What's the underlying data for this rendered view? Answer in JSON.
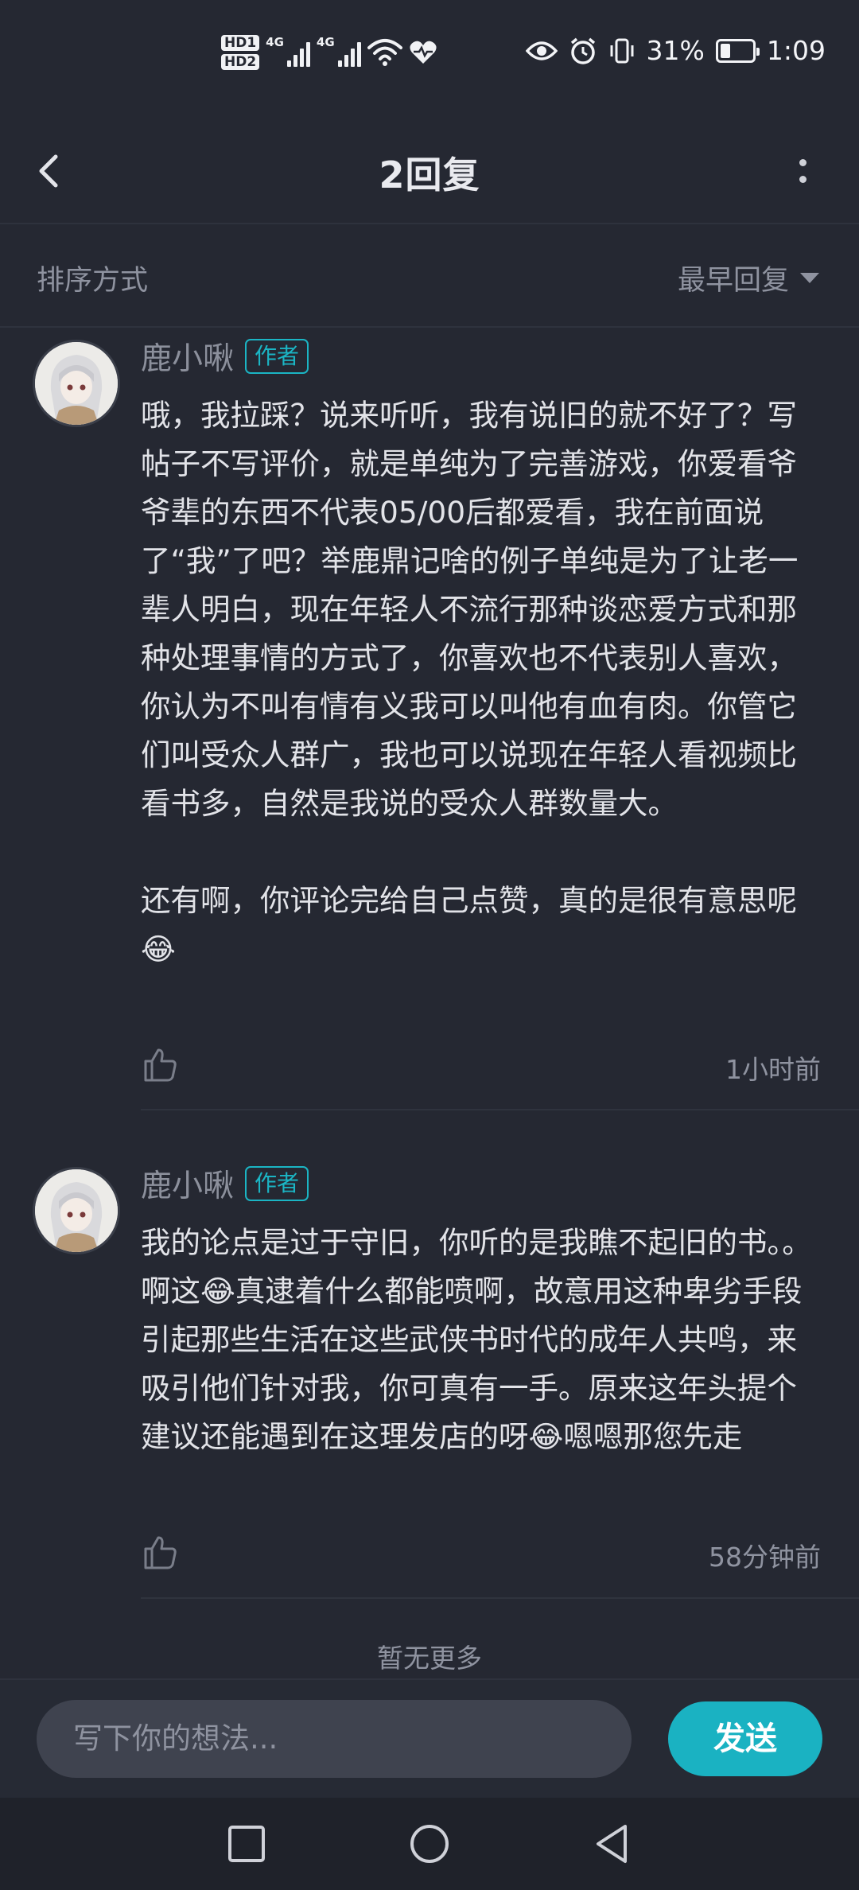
{
  "status_bar": {
    "hd1": "HD1",
    "hd2": "HD2",
    "network1": "4G",
    "network2": "4G",
    "battery_percent": "31%",
    "battery_level": 0.31,
    "time": "1:09",
    "icons": [
      "wifi-icon",
      "heart-pulse-icon",
      "eye-icon",
      "alarm-icon",
      "vibrate-icon",
      "battery-charging-icon"
    ]
  },
  "header": {
    "title": "2回复"
  },
  "sort": {
    "label": "排序方式",
    "selected": "最早回复"
  },
  "comments": [
    {
      "username": "鹿小啾",
      "badge": "作者",
      "text": "哦，我拉踩？说来听听，我有说旧的就不好了？写帖子不写评价，就是单纯为了完善游戏，你爱看爷爷辈的东西不代表05/00后都爱看，我在前面说了“我”了吧？举鹿鼎记啥的例子单纯是为了让老一辈人明白，现在年轻人不流行那种谈恋爱方式和那种处理事情的方式了，你喜欢也不代表别人喜欢，你认为不叫有情有义我可以叫他有血有肉。你管它们叫受众人群广，我也可以说现在年轻人看视频比看书多，自然是我说的受众人群数量大。\n\n还有啊，你评论完给自己点赞，真的是很有意思呢😂",
      "time": "1小时前"
    },
    {
      "username": "鹿小啾",
      "badge": "作者",
      "text": "我的论点是过于守旧，你听的是我瞧不起旧的书。。啊这😂真逮着什么都能喷啊，故意用这种卑劣手段引起那些生活在这些武侠书时代的成年人共鸣，来吸引他们针对我，你可真有一手。原来这年头提个建议还能遇到在这理发店的呀😂嗯嗯那您先走",
      "time": "58分钟前"
    }
  ],
  "footer": {
    "no_more": "暂无更多"
  },
  "input": {
    "placeholder": "写下你的想法...",
    "send_label": "发送"
  },
  "colors": {
    "background": "#252832",
    "accent": "#1ab2c2",
    "muted_text": "#8f93a0"
  }
}
